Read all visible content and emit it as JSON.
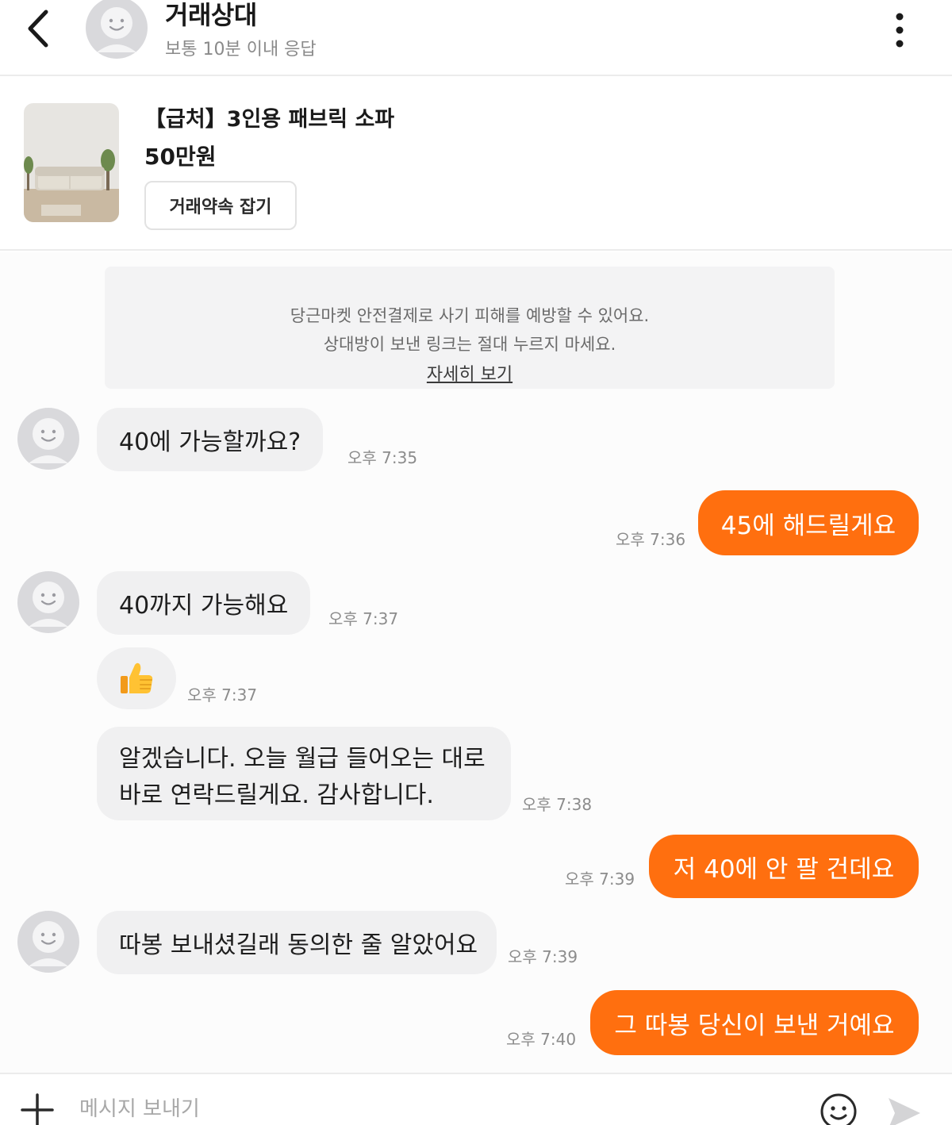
{
  "header": {
    "name": "거래상대",
    "response_time": "보통 10분 이내 응답",
    "back_icon": "chevron-left-icon",
    "more_icon": "more-vertical-icon"
  },
  "product": {
    "title": "【급처】3인용 패브릭 소파",
    "price": "50만원",
    "appointment_label": "거래약속 잡기"
  },
  "notice": {
    "line1": "당근마켓 안전결제로 사기 피해를 예방할 수 있어요.",
    "line2": "상대방이 보낸 링크는 절대 누르지 마세요.",
    "link": "자세히 보기"
  },
  "messages": [
    {
      "side": "in",
      "text": "40에 가능할까요?",
      "time": "오후 7:35"
    },
    {
      "side": "out",
      "text": "45에 해드릴게요",
      "time": "오후 7:36"
    },
    {
      "side": "in",
      "text": "40까지 가능해요",
      "time": "오후 7:37"
    },
    {
      "side": "in",
      "text": "",
      "emoji": "thumbs-up-icon",
      "time": "오후 7:37"
    },
    {
      "side": "in",
      "lines": [
        "알겠습니다. 오늘 월급 들어오는 대로",
        "바로 연락드릴게요. 감사합니다."
      ],
      "time": "오후 7:38"
    },
    {
      "side": "out",
      "text": "저 40에 안 팔 건데요",
      "time": "오후 7:39"
    },
    {
      "side": "in",
      "text": "따봉 보내셨길래 동의한 줄 알았어요",
      "time": "오후 7:39"
    },
    {
      "side": "out",
      "text": "그 따봉 당신이 보낸 거예요",
      "time": "오후 7:40"
    }
  ],
  "input": {
    "placeholder": "메시지 보내기"
  },
  "colors": {
    "accent": "#ff6f0f",
    "incoming_bubble": "#f0f0f1",
    "notice_bg": "#f3f3f4"
  }
}
